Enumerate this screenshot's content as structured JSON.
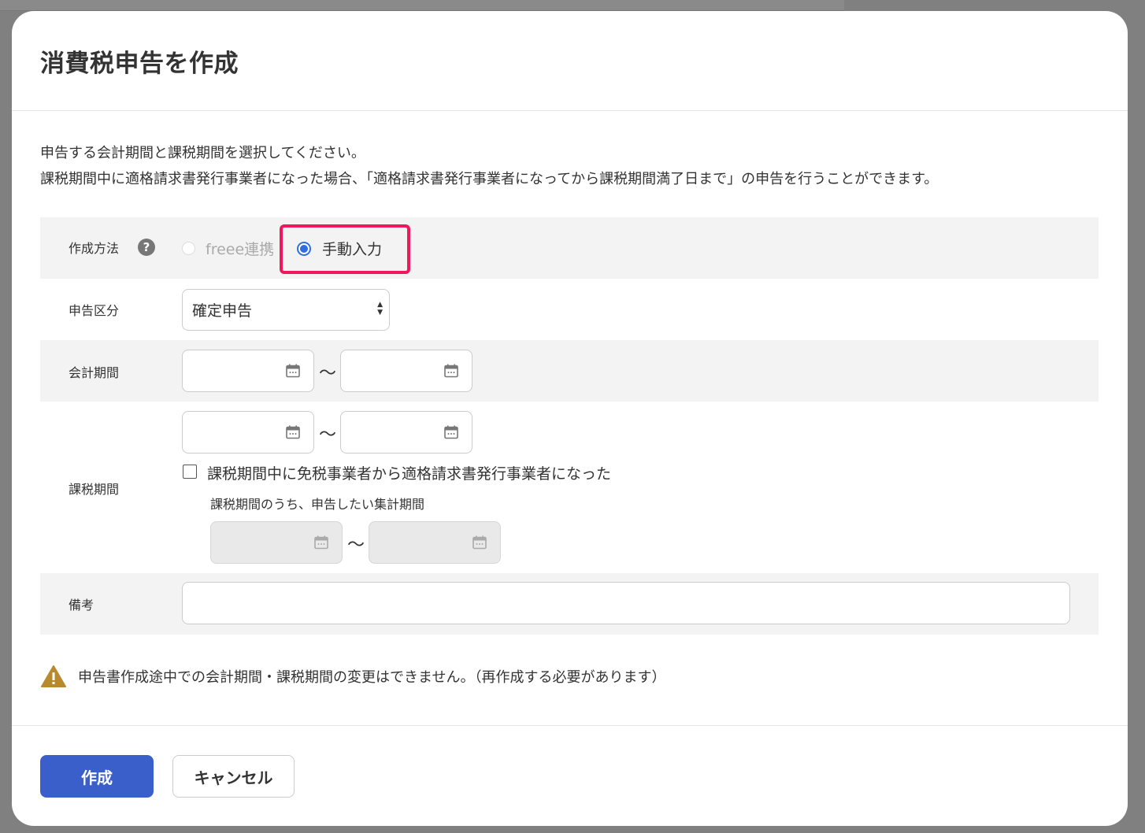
{
  "dialog": {
    "title": "消費税申告を作成",
    "description_line1": "申告する会計期間と課税期間を選択してください。",
    "description_line2": "課税期間中に適格請求書発行事業者になった場合、「適格請求書発行事業者になってから課税期間満了日まで」の申告を行うことができます。"
  },
  "form": {
    "method": {
      "label": "作成方法",
      "help_icon": "question-icon",
      "options": [
        {
          "label": "freee連携",
          "checked": false,
          "disabled": true
        },
        {
          "label": "手動入力",
          "checked": true,
          "disabled": false
        }
      ],
      "highlight_color": "#f0185c"
    },
    "filing_type": {
      "label": "申告区分",
      "selected": "確定申告"
    },
    "fiscal_period": {
      "label": "会計期間",
      "start": "",
      "end": "",
      "separator": "〜"
    },
    "tax_period": {
      "label": "課税期間",
      "start": "",
      "end": "",
      "separator": "〜",
      "checkbox_label": "課税期間中に免税事業者から適格請求書発行事業者になった",
      "checkbox_checked": false,
      "sub_label": "課税期間のうち、申告したい集計期間",
      "sub_start": "",
      "sub_end": "",
      "sub_separator": "〜"
    },
    "remarks": {
      "label": "備考",
      "value": ""
    }
  },
  "warning": {
    "icon": "warning-icon",
    "text": "申告書作成途中での会計期間・課税期間の変更はできません。（再作成する必要があります）",
    "icon_color": "#b88a2e"
  },
  "footer": {
    "create_label": "作成",
    "cancel_label": "キャンセル",
    "primary_color": "#3a5fcb"
  }
}
